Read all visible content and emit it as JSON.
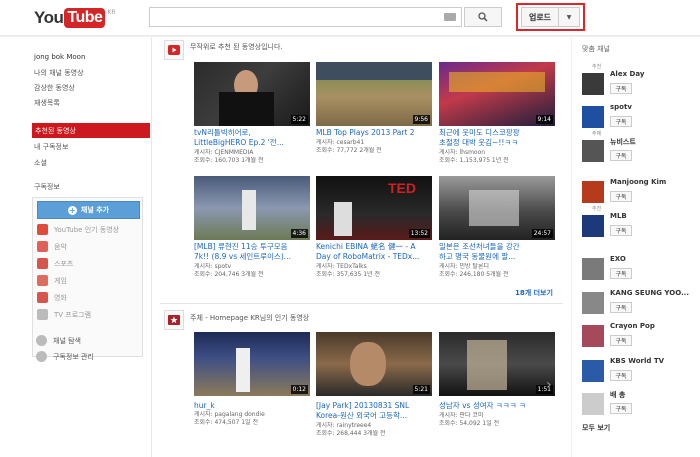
{
  "header": {
    "logo_you": "You",
    "logo_tube": "Tube",
    "logo_region": "KR",
    "search_placeholder": "",
    "upload_label": "업로드"
  },
  "sidebar": {
    "user_name": "jong bok Moon",
    "links": [
      "나의 채널 동영상",
      "감상한 동영상",
      "재생목록",
      "추천된 동영상",
      "내 구독정보",
      "소셜"
    ],
    "active_index": 3,
    "subscriptions_heading": "구독정보",
    "add_channel": "채널 추가",
    "sub_items": [
      "YouTube 인기 동영상",
      "음악",
      "스포츠",
      "게임",
      "영화",
      "TV 프로그램"
    ],
    "bottom": [
      "채널 탐색",
      "구독정보 관리"
    ]
  },
  "main": {
    "section1_title": "무작위로 추천 된 동영상입니다.",
    "section2_title": "주체 - Homepage KR님의 인기 동영상",
    "more_link": "18개 더보기",
    "videos": [
      {
        "title1": "tvN리틀빅히어로,",
        "title2": "LittleBigHERO Ep.2 '전...",
        "meta1": "게시자: CJENMMEDIA",
        "meta2": "조회수: 160,703  1개월 전",
        "duration": "5:22"
      },
      {
        "title1": "MLB Top Plays 2013 Part 2",
        "title2": "",
        "meta1": "게시자: cesarb41",
        "meta2": "조회수: 77,772  2개월 전",
        "duration": "9:56"
      },
      {
        "title1": "최근에 웃미도 디스코팡팡",
        "title2": "초절정 대박 웃김~!!ㅋㅋ",
        "meta1": "게시자: lhsmoon",
        "meta2": "조회수: 1,153,975  1년 전",
        "duration": "9:14"
      },
      {
        "title1": "[MLB] 류현진 11승 투구모음",
        "title2": "7k!! (8.9 vs 세인트루이스)...",
        "meta1": "게시자: spotv",
        "meta2": "조회수: 204,746  3개월 전",
        "duration": "4:36"
      },
      {
        "title1": "Kenichi EBINA 蛯名 健一 - A",
        "title2": "Day of RoboMatrix - TEDx...",
        "meta1": "게시자: TEDxTalks",
        "meta2": "조회수: 357,635  1년 전",
        "duration": "13:52"
      },
      {
        "title1": "일본은 조선처녀들을 강간",
        "title2": "하고 명국 동물원에 팔...",
        "meta1": "게시자: 민방 탈론디",
        "meta2": "조회수: 246,180  5개월 전",
        "duration": "24:57"
      },
      {
        "title1": "hur_k",
        "title2": "",
        "meta1": "게시자: pagalang dondie",
        "meta2": "조회수: 474,507  1일 전",
        "duration": "0:12"
      },
      {
        "title1": "[Jay Park] 20130831 SNL",
        "title2": "Korea-원산 외국어 고등학...",
        "meta1": "게시자: rainytreee4",
        "meta2": "조회수: 268,444  3개월 전",
        "duration": "5:21"
      },
      {
        "title1": "성남자 vs 성여자 ㅋㅋㅋ ㅋ",
        "title2": "",
        "meta1": "게시자: 판다 코미",
        "meta2": "조회수: 54,092  1일 전",
        "duration": "1:51"
      }
    ]
  },
  "right": {
    "heading": "맞춤 채널",
    "subscribe_label": "구독",
    "see_all": "모두 보기",
    "channels": [
      {
        "name": "Alex Day",
        "tag": "추천",
        "color": "#3a3a3a"
      },
      {
        "name": "spotv",
        "tag": "",
        "color": "#1f4fa0"
      },
      {
        "name": "뉴비스트",
        "tag": "주체",
        "color": "#555555"
      },
      {
        "name": "Manjoong Kim",
        "tag": "",
        "color": "#b63a1c"
      },
      {
        "name": "MLB",
        "tag": "추천",
        "color": "#1c3a7a"
      },
      {
        "name": "EXO",
        "tag": "",
        "color": "#7a7a7a"
      },
      {
        "name": "KANG SEUNG YOO...",
        "tag": "",
        "color": "#888888"
      },
      {
        "name": "Crayon Pop",
        "tag": "",
        "color": "#a44a5c"
      },
      {
        "name": "KBS World TV",
        "tag": "",
        "color": "#2a5aa8"
      },
      {
        "name": "배 총",
        "tag": "",
        "color": "#cccccc"
      }
    ]
  }
}
